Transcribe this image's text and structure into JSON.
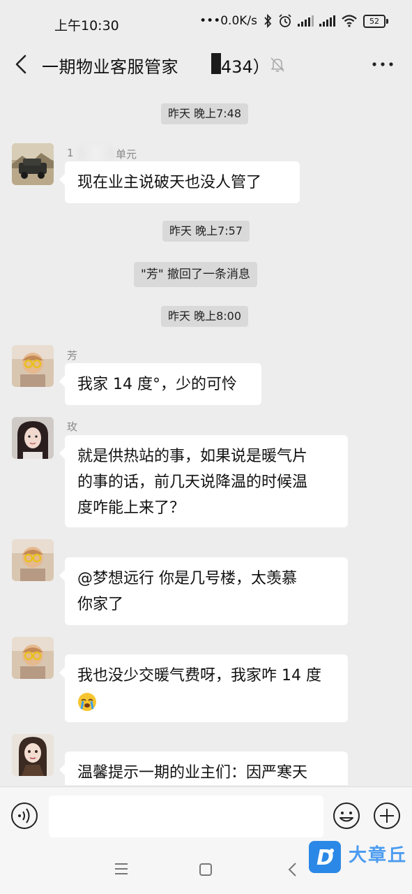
{
  "status_bar": {
    "time": "上午10:30",
    "net_speed": "•••0.0K/s",
    "battery": "52",
    "icons": [
      "bluetooth-icon",
      "alarm-icon",
      "hd-signal-icon",
      "signal-icon",
      "wifi-icon",
      "battery-icon"
    ]
  },
  "header": {
    "title": "一期物业客服管家",
    "member_count": "434）",
    "icons": [
      "back-icon",
      "mute-bell-icon",
      "more-icon"
    ]
  },
  "messages": [
    {
      "type": "time",
      "text": "昨天 晚上7:48"
    },
    {
      "type": "msg",
      "sender": "1",
      "sender_suffix": "单元",
      "text": "现在业主说破天也没人管了"
    },
    {
      "type": "time",
      "text": "昨天 晚上7:57"
    },
    {
      "type": "system",
      "text": "\"芳\" 撤回了一条消息"
    },
    {
      "type": "time",
      "text": "昨天 晚上8:00"
    },
    {
      "type": "msg",
      "sender": "芳",
      "text": "我家 14 度°，少的可怜"
    },
    {
      "type": "msg",
      "sender": "玫",
      "lines": [
        "就是供热站的事，如果说是暖气片",
        "的事的话，前几天说降温的时候温",
        "度咋能上来了？"
      ]
    },
    {
      "type": "msg",
      "sender": "",
      "lines": [
        "@梦想远行  你是几号楼，太羡慕",
        "你家了"
      ]
    },
    {
      "type": "msg",
      "sender": "",
      "lines": [
        "我也没少交暖气费呀，我家咋 14 度"
      ],
      "emoji": "crying-face-icon"
    },
    {
      "type": "msg",
      "sender": "",
      "lines": [
        "温馨提示一期的业主们：因严寒天"
      ]
    }
  ],
  "input_bar": {
    "placeholder": "",
    "icons": [
      "voice-icon",
      "emoji-icon",
      "plus-icon"
    ]
  },
  "nav_bar": {
    "icons": [
      "menu-icon",
      "home-icon",
      "back-nav-icon"
    ],
    "watermark": "大章丘",
    "watermark_logo": "D"
  },
  "colors": {
    "background": "#ededed",
    "bubble": "#ffffff",
    "time_chip": "#d9d9d9",
    "watermark": "#2b88e6"
  }
}
